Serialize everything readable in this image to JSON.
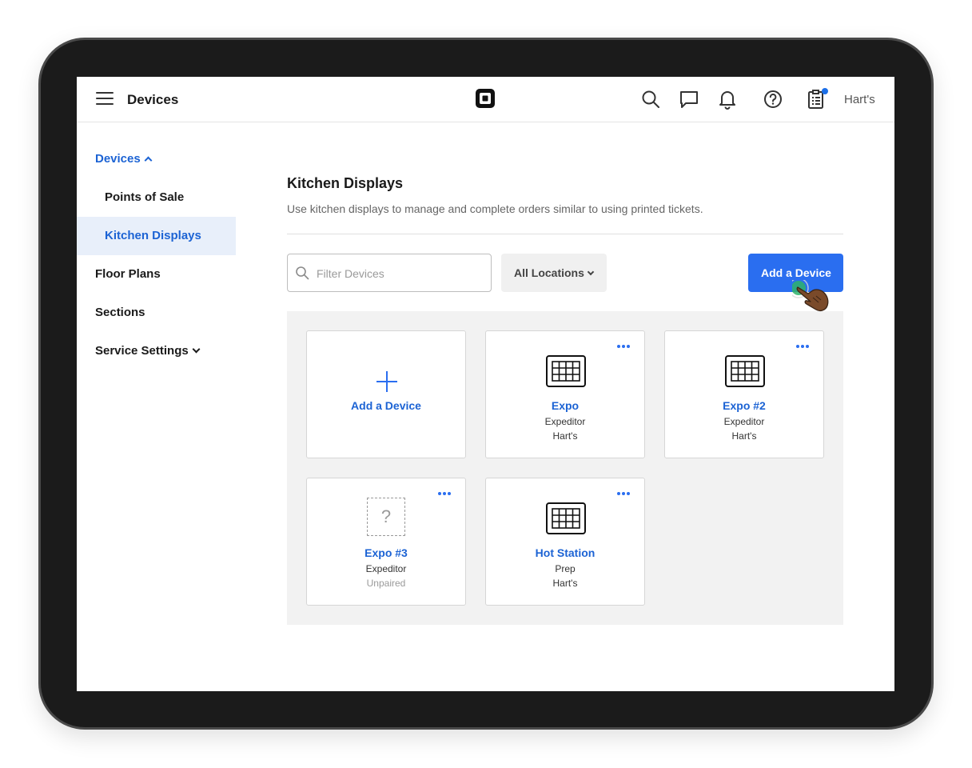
{
  "header": {
    "title": "Devices",
    "account": "Hart's",
    "accent_color": "#2a6ef0",
    "icons": [
      "menu-icon",
      "square-logo-icon",
      "search-icon",
      "chat-icon",
      "bell-icon",
      "help-icon",
      "clipboard-icon"
    ]
  },
  "sidebar": {
    "items": [
      {
        "label": "Devices"
      },
      {
        "label": "Points of Sale"
      },
      {
        "label": "Kitchen Displays"
      },
      {
        "label": "Floor Plans"
      },
      {
        "label": "Sections"
      },
      {
        "label": "Service Settings"
      }
    ]
  },
  "main": {
    "title": "Kitchen Displays",
    "description": "Use kitchen displays to manage and complete orders similar to using printed tickets.",
    "filter_placeholder": "Filter Devices",
    "locations_label": "All Locations",
    "add_button": "Add a Device",
    "cards": [
      {
        "name": "Add a Device"
      },
      {
        "name": "Expo",
        "role": "Expeditor",
        "location": "Hart's"
      },
      {
        "name": "Expo #2",
        "role": "Expeditor",
        "location": "Hart's"
      },
      {
        "name": "Expo #3",
        "role": "Expeditor",
        "location": "Unpaired",
        "icon_glyph": "?"
      },
      {
        "name": "Hot Station",
        "role": "Prep",
        "location": "Hart's"
      }
    ]
  }
}
